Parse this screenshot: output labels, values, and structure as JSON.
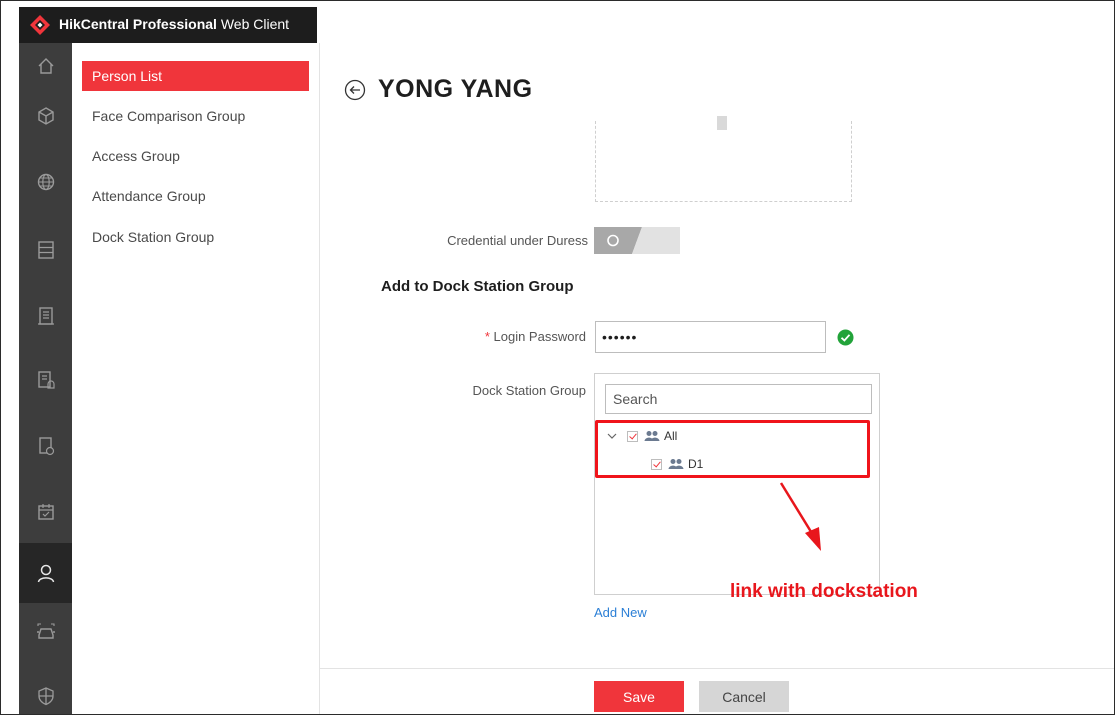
{
  "app": {
    "brand_bold": "HikCentral Professional",
    "brand_rest": " Web Client"
  },
  "rail": {
    "items": [
      "home-icon",
      "cube-icon",
      "globe-icon",
      "server-icon",
      "building-icon",
      "alarm-log-icon",
      "schedule-device-icon",
      "calendar-icon",
      "person-icon",
      "vehicle-icon",
      "shield-icon"
    ],
    "active": "person-icon"
  },
  "submenu": {
    "items": [
      {
        "label": "Person List",
        "active": true
      },
      {
        "label": "Face Comparison Group",
        "active": false
      },
      {
        "label": "Access Group",
        "active": false
      },
      {
        "label": "Attendance Group",
        "active": false
      },
      {
        "label": "Dock Station Group",
        "active": false
      }
    ]
  },
  "page": {
    "title": "YONG YANG"
  },
  "form": {
    "duress_label": "Credential under Duress",
    "duress_enabled": false,
    "section_title": "Add to Dock Station Group",
    "password_required_mark": "*",
    "password_label": "Login Password",
    "password_value": "••••••",
    "group_label": "Dock Station Group",
    "search_placeholder": "Search",
    "tree": [
      {
        "label": "All",
        "checked": true,
        "expanded": true
      },
      {
        "label": "D1",
        "checked": true
      }
    ],
    "add_new": "Add New"
  },
  "annotation": {
    "text": "link with dockstation",
    "color": "#e8161c"
  },
  "footer": {
    "save_label": "Save",
    "cancel_label": "Cancel"
  },
  "colors": {
    "accent": "#f0353b",
    "rail": "#3d3d3d",
    "brandbar": "#1d1d1d",
    "link": "#2b7fd6",
    "success": "#22a33a"
  }
}
